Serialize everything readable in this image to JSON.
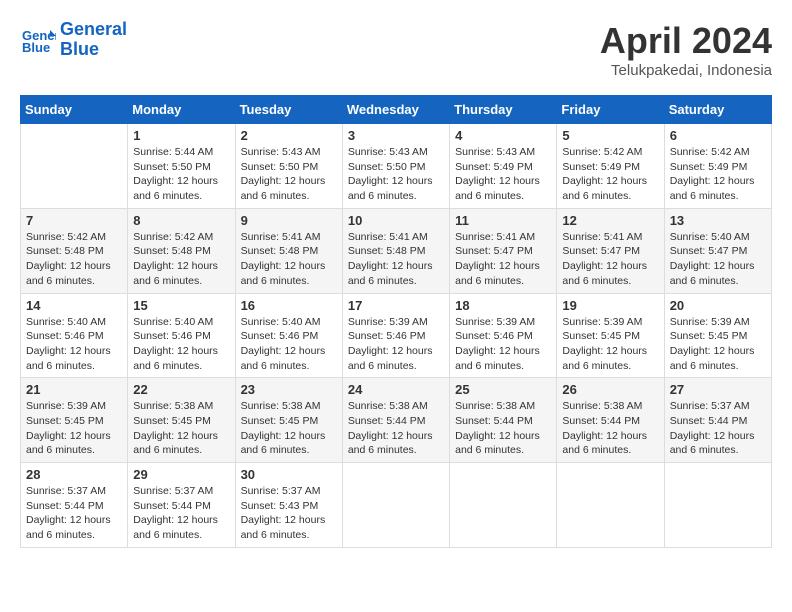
{
  "header": {
    "logo_line1": "General",
    "logo_line2": "Blue",
    "month": "April 2024",
    "location": "Telukpakedai, Indonesia"
  },
  "days_of_week": [
    "Sunday",
    "Monday",
    "Tuesday",
    "Wednesday",
    "Thursday",
    "Friday",
    "Saturday"
  ],
  "weeks": [
    [
      {
        "day": "",
        "info": ""
      },
      {
        "day": "1",
        "info": "Sunrise: 5:44 AM\nSunset: 5:50 PM\nDaylight: 12 hours\nand 6 minutes."
      },
      {
        "day": "2",
        "info": "Sunrise: 5:43 AM\nSunset: 5:50 PM\nDaylight: 12 hours\nand 6 minutes."
      },
      {
        "day": "3",
        "info": "Sunrise: 5:43 AM\nSunset: 5:50 PM\nDaylight: 12 hours\nand 6 minutes."
      },
      {
        "day": "4",
        "info": "Sunrise: 5:43 AM\nSunset: 5:49 PM\nDaylight: 12 hours\nand 6 minutes."
      },
      {
        "day": "5",
        "info": "Sunrise: 5:42 AM\nSunset: 5:49 PM\nDaylight: 12 hours\nand 6 minutes."
      },
      {
        "day": "6",
        "info": "Sunrise: 5:42 AM\nSunset: 5:49 PM\nDaylight: 12 hours\nand 6 minutes."
      }
    ],
    [
      {
        "day": "7",
        "info": "Sunrise: 5:42 AM\nSunset: 5:48 PM\nDaylight: 12 hours\nand 6 minutes."
      },
      {
        "day": "8",
        "info": "Sunrise: 5:42 AM\nSunset: 5:48 PM\nDaylight: 12 hours\nand 6 minutes."
      },
      {
        "day": "9",
        "info": "Sunrise: 5:41 AM\nSunset: 5:48 PM\nDaylight: 12 hours\nand 6 minutes."
      },
      {
        "day": "10",
        "info": "Sunrise: 5:41 AM\nSunset: 5:48 PM\nDaylight: 12 hours\nand 6 minutes."
      },
      {
        "day": "11",
        "info": "Sunrise: 5:41 AM\nSunset: 5:47 PM\nDaylight: 12 hours\nand 6 minutes."
      },
      {
        "day": "12",
        "info": "Sunrise: 5:41 AM\nSunset: 5:47 PM\nDaylight: 12 hours\nand 6 minutes."
      },
      {
        "day": "13",
        "info": "Sunrise: 5:40 AM\nSunset: 5:47 PM\nDaylight: 12 hours\nand 6 minutes."
      }
    ],
    [
      {
        "day": "14",
        "info": "Sunrise: 5:40 AM\nSunset: 5:46 PM\nDaylight: 12 hours\nand 6 minutes."
      },
      {
        "day": "15",
        "info": "Sunrise: 5:40 AM\nSunset: 5:46 PM\nDaylight: 12 hours\nand 6 minutes."
      },
      {
        "day": "16",
        "info": "Sunrise: 5:40 AM\nSunset: 5:46 PM\nDaylight: 12 hours\nand 6 minutes."
      },
      {
        "day": "17",
        "info": "Sunrise: 5:39 AM\nSunset: 5:46 PM\nDaylight: 12 hours\nand 6 minutes."
      },
      {
        "day": "18",
        "info": "Sunrise: 5:39 AM\nSunset: 5:46 PM\nDaylight: 12 hours\nand 6 minutes."
      },
      {
        "day": "19",
        "info": "Sunrise: 5:39 AM\nSunset: 5:45 PM\nDaylight: 12 hours\nand 6 minutes."
      },
      {
        "day": "20",
        "info": "Sunrise: 5:39 AM\nSunset: 5:45 PM\nDaylight: 12 hours\nand 6 minutes."
      }
    ],
    [
      {
        "day": "21",
        "info": "Sunrise: 5:39 AM\nSunset: 5:45 PM\nDaylight: 12 hours\nand 6 minutes."
      },
      {
        "day": "22",
        "info": "Sunrise: 5:38 AM\nSunset: 5:45 PM\nDaylight: 12 hours\nand 6 minutes."
      },
      {
        "day": "23",
        "info": "Sunrise: 5:38 AM\nSunset: 5:45 PM\nDaylight: 12 hours\nand 6 minutes."
      },
      {
        "day": "24",
        "info": "Sunrise: 5:38 AM\nSunset: 5:44 PM\nDaylight: 12 hours\nand 6 minutes."
      },
      {
        "day": "25",
        "info": "Sunrise: 5:38 AM\nSunset: 5:44 PM\nDaylight: 12 hours\nand 6 minutes."
      },
      {
        "day": "26",
        "info": "Sunrise: 5:38 AM\nSunset: 5:44 PM\nDaylight: 12 hours\nand 6 minutes."
      },
      {
        "day": "27",
        "info": "Sunrise: 5:37 AM\nSunset: 5:44 PM\nDaylight: 12 hours\nand 6 minutes."
      }
    ],
    [
      {
        "day": "28",
        "info": "Sunrise: 5:37 AM\nSunset: 5:44 PM\nDaylight: 12 hours\nand 6 minutes."
      },
      {
        "day": "29",
        "info": "Sunrise: 5:37 AM\nSunset: 5:44 PM\nDaylight: 12 hours\nand 6 minutes."
      },
      {
        "day": "30",
        "info": "Sunrise: 5:37 AM\nSunset: 5:43 PM\nDaylight: 12 hours\nand 6 minutes."
      },
      {
        "day": "",
        "info": ""
      },
      {
        "day": "",
        "info": ""
      },
      {
        "day": "",
        "info": ""
      },
      {
        "day": "",
        "info": ""
      }
    ]
  ]
}
